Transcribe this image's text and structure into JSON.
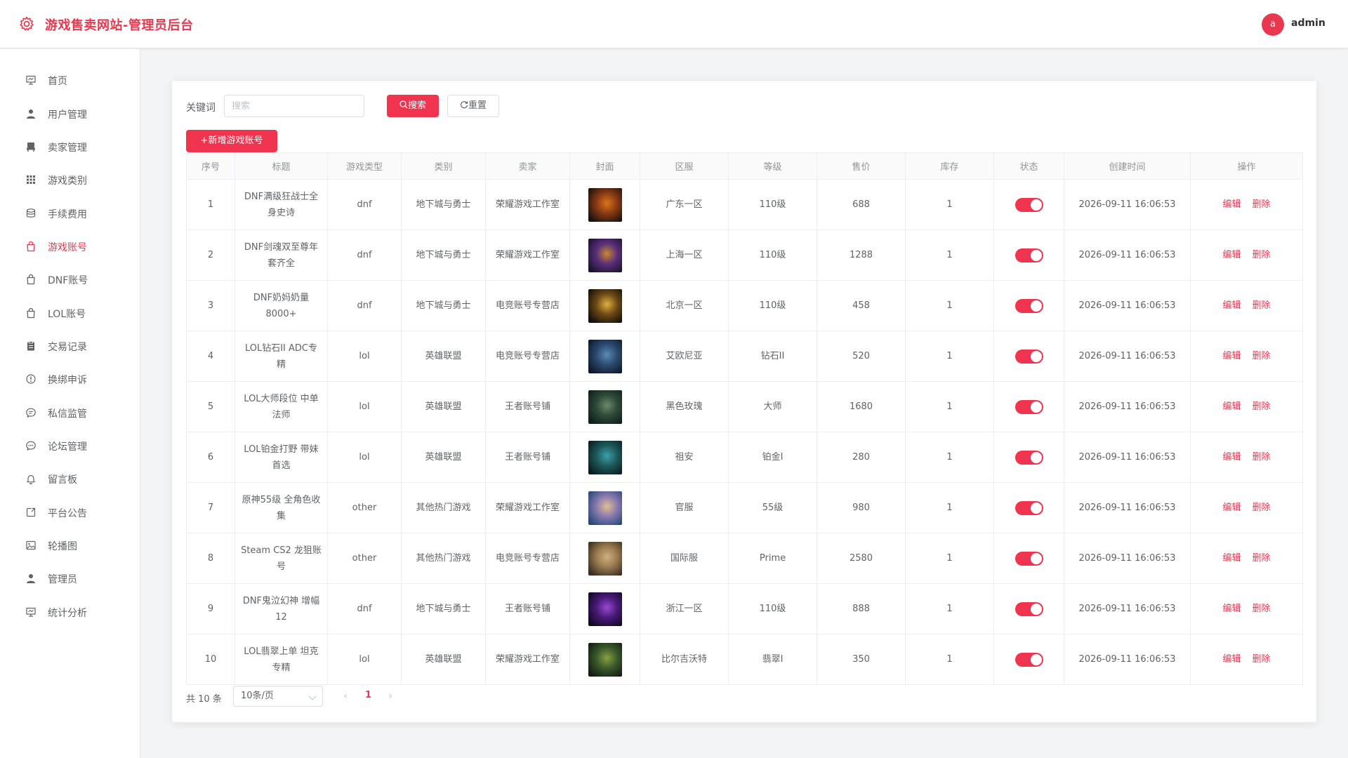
{
  "header": {
    "title": "游戏售卖网站-管理员后台",
    "avatar_letter": "a",
    "user": "admin"
  },
  "colors": {
    "accent": "#f0334f",
    "header_title": "#e8384f"
  },
  "sidebar": {
    "active_index": 5,
    "items": [
      {
        "label": "首页",
        "icon": "monitor-icon"
      },
      {
        "label": "用户管理",
        "icon": "user-icon"
      },
      {
        "label": "卖家管理",
        "icon": "chair-icon"
      },
      {
        "label": "游戏类别",
        "icon": "grid-icon"
      },
      {
        "label": "手续费用",
        "icon": "coins-icon"
      },
      {
        "label": "游戏账号",
        "icon": "shopping-bag-icon"
      },
      {
        "label": "DNF账号",
        "icon": "shopping-bag-icon"
      },
      {
        "label": "LOL账号",
        "icon": "shopping-bag-icon"
      },
      {
        "label": "交易记录",
        "icon": "clipboard-icon"
      },
      {
        "label": "换绑申诉",
        "icon": "warning-circle-icon"
      },
      {
        "label": "私信监管",
        "icon": "chat-icon"
      },
      {
        "label": "论坛管理",
        "icon": "chat-dots-icon"
      },
      {
        "label": "留言板",
        "icon": "bell-icon"
      },
      {
        "label": "平台公告",
        "icon": "notice-icon"
      },
      {
        "label": "轮播图",
        "icon": "picture-icon"
      },
      {
        "label": "管理员",
        "icon": "user-icon"
      },
      {
        "label": "统计分析",
        "icon": "monitor-icon"
      }
    ]
  },
  "toolbar": {
    "keyword_label": "关键词",
    "search_placeholder": "搜索",
    "search_label": "搜索",
    "reset_label": "重置",
    "add_label": "新增游戏账号"
  },
  "table": {
    "columns": [
      "序号",
      "标题",
      "游戏类型",
      "类别",
      "卖家",
      "封面",
      "区服",
      "等级",
      "售价",
      "库存",
      "状态",
      "创建时间",
      "操作"
    ],
    "edit_label": "编辑",
    "delete_label": "删除",
    "rows": [
      {
        "no": "1",
        "title": "DNF满级狂战士全身史诗",
        "type": "dnf",
        "category": "地下城与勇士",
        "seller": "荣耀游戏工作室",
        "cover": [
          "#1a1210",
          "#8a3a12",
          "#d8751e"
        ],
        "server": "广东一区",
        "level": "110级",
        "price": "688",
        "stock": "1",
        "status": true,
        "created": "2026-09-11 16:06:53"
      },
      {
        "no": "2",
        "title": "DNF剑魂双至尊年套齐全",
        "type": "dnf",
        "category": "地下城与勇士",
        "seller": "荣耀游戏工作室",
        "cover": [
          "#1d1430",
          "#5b2f7a",
          "#c8892c"
        ],
        "server": "上海一区",
        "level": "110级",
        "price": "1288",
        "stock": "1",
        "status": true,
        "created": "2026-09-11 16:06:53"
      },
      {
        "no": "3",
        "title": "DNF奶妈奶量8000+",
        "type": "dnf",
        "category": "地下城与勇士",
        "seller": "电竞账号专营店",
        "cover": [
          "#14100c",
          "#6e4a14",
          "#e0b040"
        ],
        "server": "北京一区",
        "level": "110级",
        "price": "458",
        "stock": "1",
        "status": true,
        "created": "2026-09-11 16:06:53"
      },
      {
        "no": "4",
        "title": "LOL钻石II ADC专精",
        "type": "lol",
        "category": "英雄联盟",
        "seller": "电竞账号专营店",
        "cover": [
          "#0e1a2c",
          "#2c4a70",
          "#5a8ab8"
        ],
        "server": "艾欧尼亚",
        "level": "钻石II",
        "price": "520",
        "stock": "1",
        "status": true,
        "created": "2026-09-11 16:06:53"
      },
      {
        "no": "5",
        "title": "LOL大师段位 中单法师",
        "type": "lol",
        "category": "英雄联盟",
        "seller": "王者账号铺",
        "cover": [
          "#12201a",
          "#2e4a3a",
          "#6a8a6a"
        ],
        "server": "黑色玫瑰",
        "level": "大师",
        "price": "1680",
        "stock": "1",
        "status": true,
        "created": "2026-09-11 16:06:53"
      },
      {
        "no": "6",
        "title": "LOL铂金打野 带妹首选",
        "type": "lol",
        "category": "英雄联盟",
        "seller": "王者账号铺",
        "cover": [
          "#0c1e22",
          "#1e5a5a",
          "#3aa0b0"
        ],
        "server": "祖安",
        "level": "铂金I",
        "price": "280",
        "stock": "1",
        "status": true,
        "created": "2026-09-11 16:06:53"
      },
      {
        "no": "7",
        "title": "原神55级 全角色收集",
        "type": "other",
        "category": "其他热门游戏",
        "seller": "荣耀游戏工作室",
        "cover": [
          "#2a4a7a",
          "#8a7ab0",
          "#e0c090"
        ],
        "server": "官服",
        "level": "55级",
        "price": "980",
        "stock": "1",
        "status": true,
        "created": "2026-09-11 16:06:53"
      },
      {
        "no": "8",
        "title": "Steam CS2 龙狙账号",
        "type": "other",
        "category": "其他热门游戏",
        "seller": "电竞账号专营店",
        "cover": [
          "#3a3020",
          "#9a7a50",
          "#d0b080"
        ],
        "server": "国际服",
        "level": "Prime",
        "price": "2580",
        "stock": "1",
        "status": true,
        "created": "2026-09-11 16:06:53"
      },
      {
        "no": "9",
        "title": "DNF鬼泣幻神 增幅12",
        "type": "dnf",
        "category": "地下城与勇士",
        "seller": "王者账号铺",
        "cover": [
          "#120a24",
          "#4a1a7a",
          "#9a4ad0"
        ],
        "server": "浙江一区",
        "level": "110级",
        "price": "888",
        "stock": "1",
        "status": true,
        "created": "2026-09-11 16:06:53"
      },
      {
        "no": "10",
        "title": "LOL翡翠上单 坦克专精",
        "type": "lol",
        "category": "英雄联盟",
        "seller": "荣耀游戏工作室",
        "cover": [
          "#141e14",
          "#3a5a2a",
          "#8aa040"
        ],
        "server": "比尔吉沃特",
        "level": "翡翠I",
        "price": "350",
        "stock": "1",
        "status": true,
        "created": "2026-09-11 16:06:53"
      }
    ]
  },
  "pagination": {
    "total_text": "共 10 条",
    "page_size": "10条/页",
    "current_page": "1"
  }
}
